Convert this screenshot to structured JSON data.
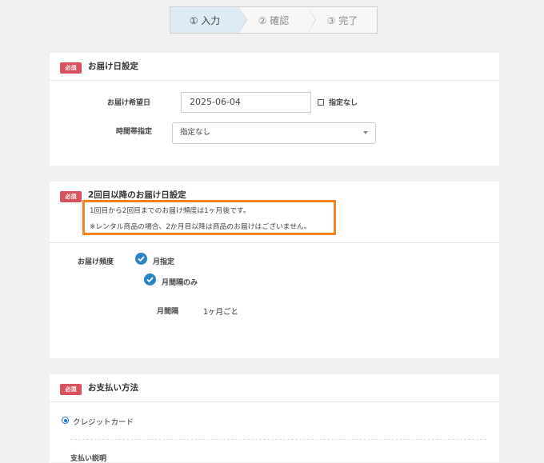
{
  "steps": [
    {
      "label": "① 入力",
      "active": true
    },
    {
      "label": "② 確認",
      "active": false
    },
    {
      "label": "③ 完了",
      "active": false
    }
  ],
  "required_badge": "必須",
  "delivery_date": {
    "title": "お届け日設定",
    "date_label": "お届け希望日",
    "date_value": "2025-06-04",
    "no_preference_label": "指定なし",
    "time_label": "時間帯指定",
    "time_value": "指定なし"
  },
  "recurring": {
    "title": "2回目以降のお届け日設定",
    "note_line1": "1回目から2回目までのお届け頻度は1ヶ月後です。",
    "note_line2": "※レンタル商品の場合、2か月目以降は商品のお届けはございません。",
    "frequency_label": "お届け頻度",
    "option_monthly": "月指定",
    "option_interval_only": "月間隔のみ",
    "interval_label": "月間隔",
    "interval_value": "1ヶ月ごと"
  },
  "payment": {
    "title": "お支払い方法",
    "option_credit": "クレジットカード",
    "description_label": "支払い説明"
  },
  "colors": {
    "accent": "#2a83c3",
    "required": "#d9505f",
    "highlight": "#f5821f",
    "step_active": "#dcebf4"
  }
}
